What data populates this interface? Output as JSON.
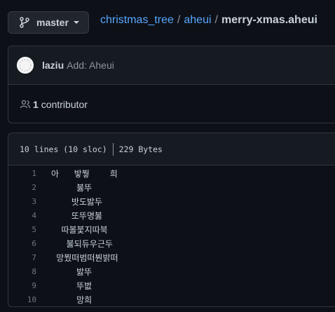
{
  "branch": {
    "label": "master",
    "icon": "git-branch-icon"
  },
  "breadcrumb": {
    "repo": "christmas_tree",
    "separator": "/",
    "folder": "aheui",
    "file": "merry-xmas.aheui"
  },
  "commit": {
    "author": "laziu",
    "message": "Add: Aheui"
  },
  "contributors": {
    "count": "1",
    "label": "contributor"
  },
  "file": {
    "lines_info": "10 lines (10 sloc)",
    "size": "229 Bytes",
    "lines": [
      {
        "num": "1",
        "text": "아   밯붷    희"
      },
      {
        "num": "2",
        "text": "     붏뚜"
      },
      {
        "num": "3",
        "text": "    밧도밣두"
      },
      {
        "num": "4",
        "text": "    또뚜명붏"
      },
      {
        "num": "5",
        "text": "  따볼붗지따북"
      },
      {
        "num": "6",
        "text": "   붏되듀우근두"
      },
      {
        "num": "7",
        "text": " 망붰떠범떠붠밝떠"
      },
      {
        "num": "8",
        "text": "     밣뚜"
      },
      {
        "num": "9",
        "text": "     뚜벖"
      },
      {
        "num": "10",
        "text": "     망희"
      }
    ]
  }
}
